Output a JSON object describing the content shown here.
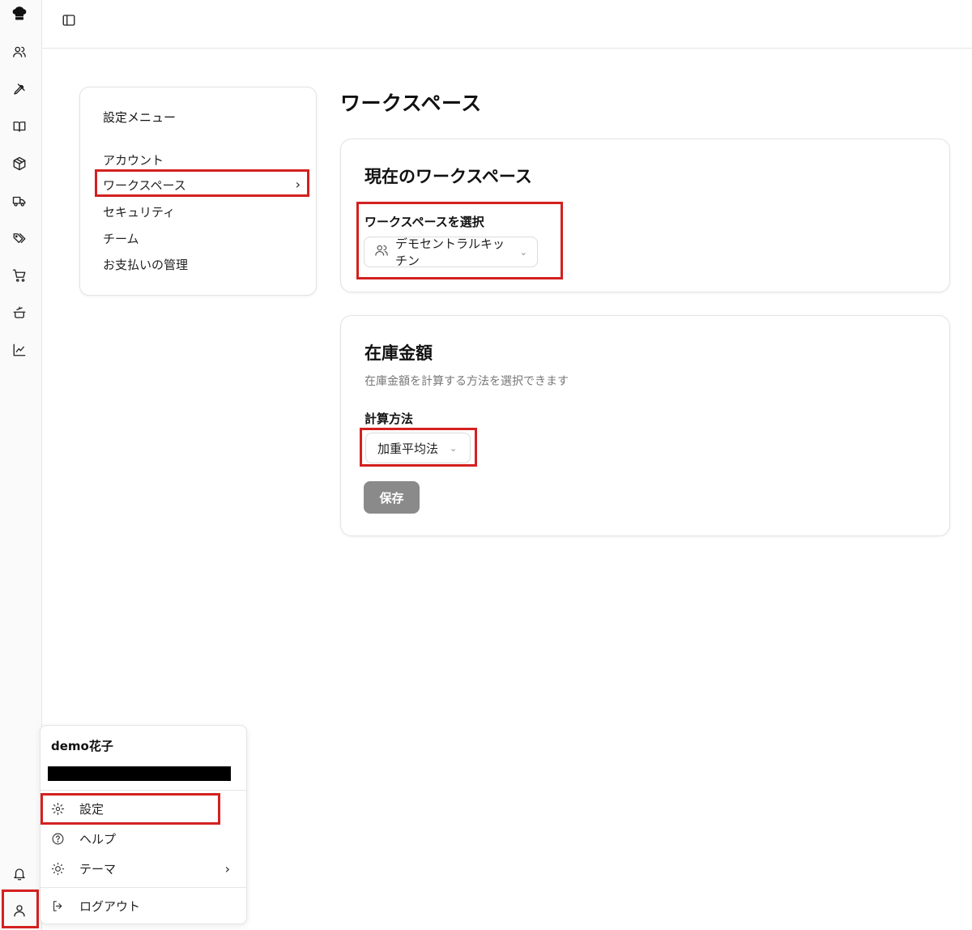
{
  "settings_menu": {
    "title": "設定メニュー",
    "items": [
      {
        "label": "アカウント"
      },
      {
        "label": "ワークスペース"
      },
      {
        "label": "セキュリティ"
      },
      {
        "label": "チーム"
      },
      {
        "label": "お支払いの管理"
      }
    ],
    "active_chevron": "›"
  },
  "page": {
    "title": "ワークスペース"
  },
  "current_workspace": {
    "title": "現在のワークスペース",
    "field_label": "ワークスペースを選択",
    "selected": "デモセントラルキッチン"
  },
  "inventory_value": {
    "title": "在庫金額",
    "description": "在庫金額を計算する方法を選択できます",
    "field_label": "計算方法",
    "selected": "加重平均法",
    "save_label": "保存"
  },
  "user_menu": {
    "name": "demo花子",
    "items": [
      {
        "label": "設定",
        "icon": "gear-icon"
      },
      {
        "label": "ヘルプ",
        "icon": "help-circle-icon"
      },
      {
        "label": "テーマ",
        "icon": "sun-icon"
      },
      {
        "label": "ログアウト",
        "icon": "logout-icon"
      }
    ],
    "theme_chevron": "›"
  },
  "rail": {
    "icons": [
      "chef-hat-icon",
      "users-icon",
      "pen-icon",
      "book-icon",
      "package-icon",
      "truck-icon",
      "tags-icon",
      "cart-icon",
      "cooking-pot-icon",
      "chart-icon",
      "bell-icon",
      "user-icon"
    ]
  },
  "colors": {
    "highlight": "#d42020",
    "save_button_bg": "#8a8a8a"
  }
}
